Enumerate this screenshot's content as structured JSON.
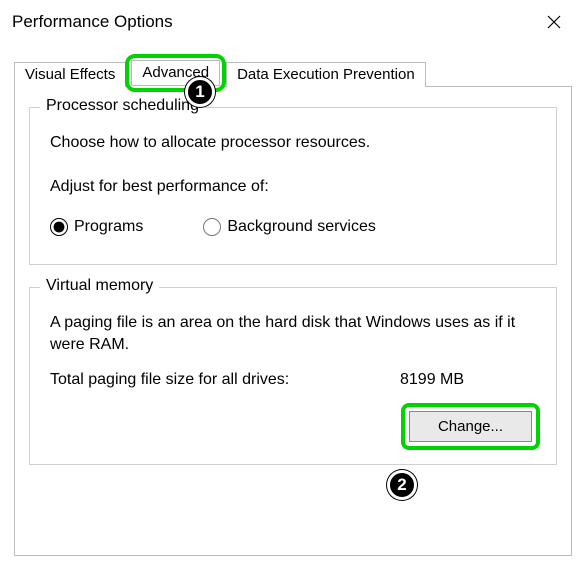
{
  "window": {
    "title": "Performance Options"
  },
  "tabs": {
    "visual_effects": "Visual Effects",
    "advanced": "Advanced",
    "dep": "Data Execution Prevention"
  },
  "processor": {
    "legend": "Processor scheduling",
    "description": "Choose how to allocate processor resources.",
    "adjust_label": "Adjust for best performance of:",
    "programs_label": "Programs",
    "background_label": "Background services"
  },
  "virtual_memory": {
    "legend": "Virtual memory",
    "description": "A paging file is an area on the hard disk that Windows uses as if it were RAM.",
    "total_label": "Total paging file size for all drives:",
    "total_value": "8199 MB",
    "change_button": "Change..."
  },
  "annotations": {
    "step1": "1",
    "step2": "2"
  }
}
